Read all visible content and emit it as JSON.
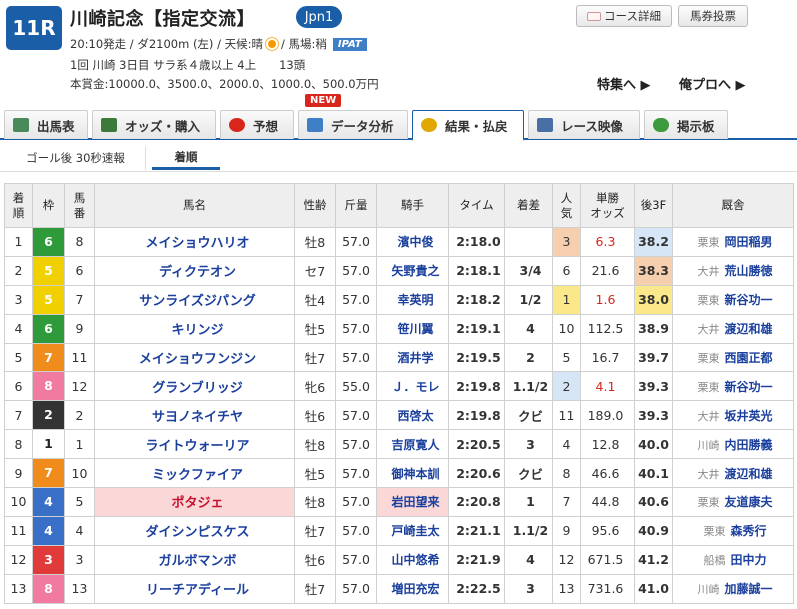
{
  "race": {
    "number": "11R",
    "title": "川崎記念【指定交流】",
    "grade": "Jpn1",
    "info1_pre": "20:10発走 / ダ2100m (左) / 天候:晴",
    "info1_post": "/ 馬場:稍",
    "ipat": "IPAT",
    "info2": "1回 川崎 3日目 サラ系４歳以上 4上　　13頭",
    "info3": "本賞金:10000.0、3500.0、2000.0、1000.0、500.0万円"
  },
  "header_buttons": {
    "course": "コース詳細",
    "baken": "馬券投票"
  },
  "links": {
    "tokushu": "特集へ ▶",
    "orepro": "俺プロへ ▶"
  },
  "new_badge": "NEW",
  "tabs": [
    {
      "label": "出馬表",
      "color": "#4a8a5a"
    },
    {
      "label": "オッズ・購入",
      "color": "#3c7a3c"
    },
    {
      "label": "予想",
      "color": "#d8261c"
    },
    {
      "label": "データ分析",
      "color": "#3f7fc6"
    },
    {
      "label": "結果・払戻",
      "color": "#e0a800"
    },
    {
      "label": "レース映像",
      "color": "#4a6fa5"
    },
    {
      "label": "掲示板",
      "color": "#3c9a3c"
    }
  ],
  "subtabs": {
    "goal": "ゴール後 30秒速報",
    "chaku": "着順"
  },
  "table": {
    "headers": {
      "chaku": "着\n順",
      "waku": "枠",
      "uma": "馬\n番",
      "name": "馬名",
      "seirei": "性齢",
      "kinryo": "斤量",
      "jockey": "騎手",
      "time": "タイム",
      "chakusa": "着差",
      "ninki": "人\n気",
      "odds": "単勝\nオッズ",
      "f3": "後3F",
      "trainer": "厩舎"
    },
    "waku_colors": {
      "1": {
        "bg": "#ffffff",
        "fg": "#222222"
      },
      "2": {
        "bg": "#333333",
        "fg": "#ffffff"
      },
      "3": {
        "bg": "#e03a3a",
        "fg": "#ffffff"
      },
      "4": {
        "bg": "#3a6fc8",
        "fg": "#ffffff"
      },
      "5": {
        "bg": "#f1d000",
        "fg": "#ffffff"
      },
      "6": {
        "bg": "#2f9a3a",
        "fg": "#ffffff"
      },
      "7": {
        "bg": "#f08c1c",
        "fg": "#ffffff"
      },
      "8": {
        "bg": "#f07aa0",
        "fg": "#ffffff"
      }
    },
    "rows": [
      {
        "chaku": "1",
        "waku": "6",
        "uma": "8",
        "name": "メイショウハリオ",
        "seirei": "牡8",
        "kinryo": "57.0",
        "jockey": "濱中俊",
        "time": "2:18.0",
        "chakusa": "",
        "ninki": "3",
        "ninki_bg": "#f6cfae",
        "odds": "6.3",
        "odds_hot": true,
        "f3": "38.2",
        "f3_bg": "#d7e6f7",
        "area": "栗東",
        "trainer": "岡田稲男"
      },
      {
        "chaku": "2",
        "waku": "5",
        "uma": "6",
        "name": "ディクテオン",
        "seirei": "セ7",
        "kinryo": "57.0",
        "jockey": "矢野貴之",
        "time": "2:18.1",
        "chakusa": "3/4",
        "ninki": "6",
        "ninki_bg": "",
        "odds": "21.6",
        "odds_hot": false,
        "f3": "38.3",
        "f3_bg": "#f6cfae",
        "area": "大井",
        "trainer": "荒山勝徳"
      },
      {
        "chaku": "3",
        "waku": "5",
        "uma": "7",
        "name": "サンライズジパング",
        "seirei": "牡4",
        "kinryo": "57.0",
        "jockey": "幸英明",
        "time": "2:18.2",
        "chakusa": "1/2",
        "ninki": "1",
        "ninki_bg": "#fbe88a",
        "odds": "1.6",
        "odds_hot": true,
        "f3": "38.0",
        "f3_bg": "#fbe88a",
        "area": "栗東",
        "trainer": "新谷功一"
      },
      {
        "chaku": "4",
        "waku": "6",
        "uma": "9",
        "name": "キリンジ",
        "seirei": "牡5",
        "kinryo": "57.0",
        "jockey": "笹川翼",
        "time": "2:19.1",
        "chakusa": "4",
        "ninki": "10",
        "ninki_bg": "",
        "odds": "112.5",
        "odds_hot": false,
        "f3": "38.9",
        "f3_bg": "",
        "area": "大井",
        "trainer": "渡辺和雄"
      },
      {
        "chaku": "5",
        "waku": "7",
        "uma": "11",
        "name": "メイショウフンジン",
        "seirei": "牡7",
        "kinryo": "57.0",
        "jockey": "酒井学",
        "time": "2:19.5",
        "chakusa": "2",
        "ninki": "5",
        "ninki_bg": "",
        "odds": "16.7",
        "odds_hot": false,
        "f3": "39.7",
        "f3_bg": "",
        "area": "栗東",
        "trainer": "西園正都"
      },
      {
        "chaku": "6",
        "waku": "8",
        "uma": "12",
        "name": "グランブリッジ",
        "seirei": "牝6",
        "kinryo": "55.0",
        "jockey": "Ｊ．モレ",
        "time": "2:19.8",
        "chakusa": "1.1/2",
        "ninki": "2",
        "ninki_bg": "#d7e6f7",
        "odds": "4.1",
        "odds_hot": true,
        "f3": "39.3",
        "f3_bg": "",
        "area": "栗東",
        "trainer": "新谷功一"
      },
      {
        "chaku": "7",
        "waku": "2",
        "uma": "2",
        "name": "サヨノネイチヤ",
        "seirei": "牡6",
        "kinryo": "57.0",
        "jockey": "西啓太",
        "time": "2:19.8",
        "chakusa": "クビ",
        "ninki": "11",
        "ninki_bg": "",
        "odds": "189.0",
        "odds_hot": false,
        "f3": "39.3",
        "f3_bg": "",
        "area": "大井",
        "trainer": "坂井英光"
      },
      {
        "chaku": "8",
        "waku": "1",
        "uma": "1",
        "name": "ライトウォーリア",
        "seirei": "牡8",
        "kinryo": "57.0",
        "jockey": "吉原寛人",
        "time": "2:20.5",
        "chakusa": "3",
        "ninki": "4",
        "ninki_bg": "",
        "odds": "12.8",
        "odds_hot": false,
        "f3": "40.0",
        "f3_bg": "",
        "area": "川崎",
        "trainer": "内田勝義"
      },
      {
        "chaku": "9",
        "waku": "7",
        "uma": "10",
        "name": "ミックファイア",
        "seirei": "牡5",
        "kinryo": "57.0",
        "jockey": "御神本訓",
        "time": "2:20.6",
        "chakusa": "クビ",
        "ninki": "8",
        "ninki_bg": "",
        "odds": "46.6",
        "odds_hot": false,
        "f3": "40.1",
        "f3_bg": "",
        "area": "大井",
        "trainer": "渡辺和雄"
      },
      {
        "chaku": "10",
        "waku": "4",
        "uma": "5",
        "name": "ポタジェ",
        "seirei": "牡8",
        "kinryo": "57.0",
        "jockey": "岩田望来",
        "time": "2:20.8",
        "chakusa": "1",
        "ninki": "7",
        "ninki_bg": "",
        "odds": "44.8",
        "odds_hot": false,
        "f3": "40.6",
        "f3_bg": "",
        "area": "栗東",
        "trainer": "友道康夫",
        "highlight": true
      },
      {
        "chaku": "11",
        "waku": "4",
        "uma": "4",
        "name": "ダイシンピスケス",
        "seirei": "牡7",
        "kinryo": "57.0",
        "jockey": "戸崎圭太",
        "time": "2:21.1",
        "chakusa": "1.1/2",
        "ninki": "9",
        "ninki_bg": "",
        "odds": "95.6",
        "odds_hot": false,
        "f3": "40.9",
        "f3_bg": "",
        "area": "栗東",
        "trainer": "森秀行"
      },
      {
        "chaku": "12",
        "waku": "3",
        "uma": "3",
        "name": "ガルボマンボ",
        "seirei": "牡6",
        "kinryo": "57.0",
        "jockey": "山中悠希",
        "time": "2:21.9",
        "chakusa": "4",
        "ninki": "12",
        "ninki_bg": "",
        "odds": "671.5",
        "odds_hot": false,
        "f3": "41.2",
        "f3_bg": "",
        "area": "船橋",
        "trainer": "田中力"
      },
      {
        "chaku": "13",
        "waku": "8",
        "uma": "13",
        "name": "リーチアディール",
        "seirei": "牡7",
        "kinryo": "57.0",
        "jockey": "増田充宏",
        "time": "2:22.5",
        "chakusa": "3",
        "ninki": "13",
        "ninki_bg": "",
        "odds": "731.6",
        "odds_hot": false,
        "f3": "41.0",
        "f3_bg": "",
        "area": "川崎",
        "trainer": "加藤誠一"
      }
    ]
  }
}
